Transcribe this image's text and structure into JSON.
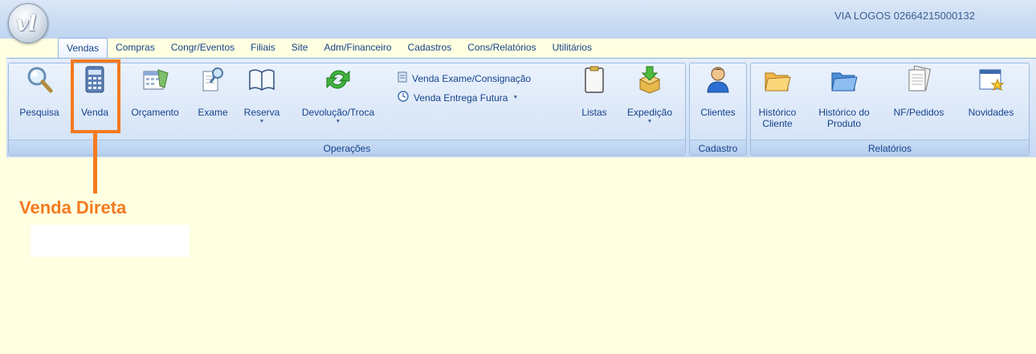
{
  "window": {
    "title": "VIA LOGOS 02664215000132"
  },
  "tabs": [
    "Vendas",
    "Compras",
    "Congr/Eventos",
    "Filiais",
    "Site",
    "Adm/Financeiro",
    "Cadastros",
    "Cons/Relatórios",
    "Utilitários"
  ],
  "ribbon": {
    "operacoes": {
      "label": "Operações",
      "pesquisa": "Pesquisa",
      "venda": "Venda",
      "orcamento": "Orçamento",
      "exame": "Exame",
      "reserva": "Reserva",
      "devolucao": "Devolução/Troca",
      "venda_exame": "Venda Exame/Consignação",
      "venda_entrega": "Venda Entrega Futura",
      "listas": "Listas",
      "expedicao": "Expedição"
    },
    "cadastro": {
      "label": "Cadastro",
      "clientes": "Clientes"
    },
    "relatorios": {
      "label": "Relatórios",
      "historico_cliente": "Histórico Cliente",
      "historico_produto": "Histórico do Produto",
      "nf_pedidos": "NF/Pedidos",
      "novidades": "Novidades"
    }
  },
  "annotation": {
    "callout": "Venda Direta",
    "color": "#f47a20"
  }
}
